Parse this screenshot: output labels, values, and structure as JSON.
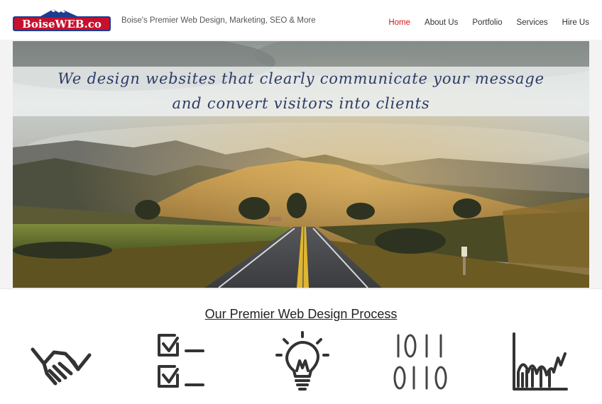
{
  "header": {
    "logo": {
      "text": "BoiseWEB.co",
      "icon": "mountain-logo"
    },
    "tagline": "Boise's Premier Web Design, Marketing, SEO & More",
    "nav": [
      {
        "label": "Home",
        "active": true
      },
      {
        "label": "About Us",
        "active": false
      },
      {
        "label": "Portfolio",
        "active": false
      },
      {
        "label": "Services",
        "active": false
      },
      {
        "label": "Hire Us",
        "active": false
      }
    ]
  },
  "hero": {
    "line1": "We design websites that clearly communicate your message",
    "line2": "and convert visitors into clients",
    "image": "mountain-road-landscape"
  },
  "process": {
    "title": "Our Premier Web Design Process",
    "icons": [
      "handshake-icon",
      "checklist-icon",
      "lightbulb-icon",
      "binary-code-icon",
      "growth-chart-icon"
    ]
  },
  "colors": {
    "nav_active": "#d11a1a",
    "logo_red": "#c8102e",
    "logo_blue": "#1d3d8f",
    "banner_text": "#2d3c66"
  }
}
